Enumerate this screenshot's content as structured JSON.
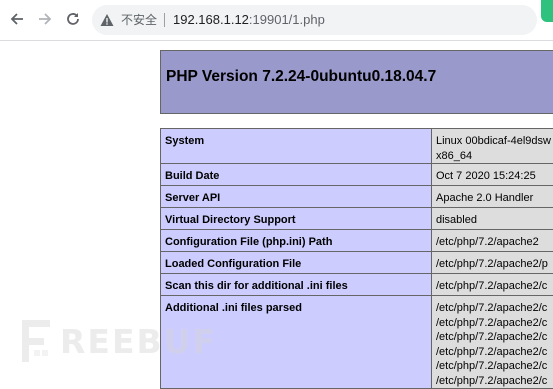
{
  "browser": {
    "security_label": "不安全",
    "url_host": "192.168.1.12",
    "url_port": ":19901",
    "url_path": "/1.php"
  },
  "page": {
    "title": "PHP Version 7.2.24-0ubuntu0.18.04.7",
    "rows": [
      {
        "key": "System",
        "values": [
          "Linux 00bdicaf-4el9dsw",
          "x86_64"
        ]
      },
      {
        "key": "Build Date",
        "values": [
          "Oct 7 2020 15:24:25"
        ]
      },
      {
        "key": "Server API",
        "values": [
          "Apache 2.0 Handler"
        ]
      },
      {
        "key": "Virtual Directory Support",
        "values": [
          "disabled"
        ]
      },
      {
        "key": "Configuration File (php.ini) Path",
        "values": [
          "/etc/php/7.2/apache2"
        ]
      },
      {
        "key": "Loaded Configuration File",
        "values": [
          "/etc/php/7.2/apache2/p"
        ]
      },
      {
        "key": "Scan this dir for additional .ini files",
        "values": [
          "/etc/php/7.2/apache2/c"
        ]
      },
      {
        "key": "Additional .ini files parsed",
        "values": [
          "/etc/php/7.2/apache2/c",
          "/etc/php/7.2/apache2/c",
          "/etc/php/7.2/apache2/c",
          "/etc/php/7.2/apache2/c",
          "/etc/php/7.2/apache2/c",
          "/etc/php/7.2/apache2/c"
        ]
      }
    ]
  },
  "watermark": {
    "text": "REEBUF"
  },
  "colors": {
    "header_bg": "#9999cc",
    "key_cell_bg": "#ccccff",
    "value_cell_bg": "#dddddd",
    "border": "#666666"
  }
}
